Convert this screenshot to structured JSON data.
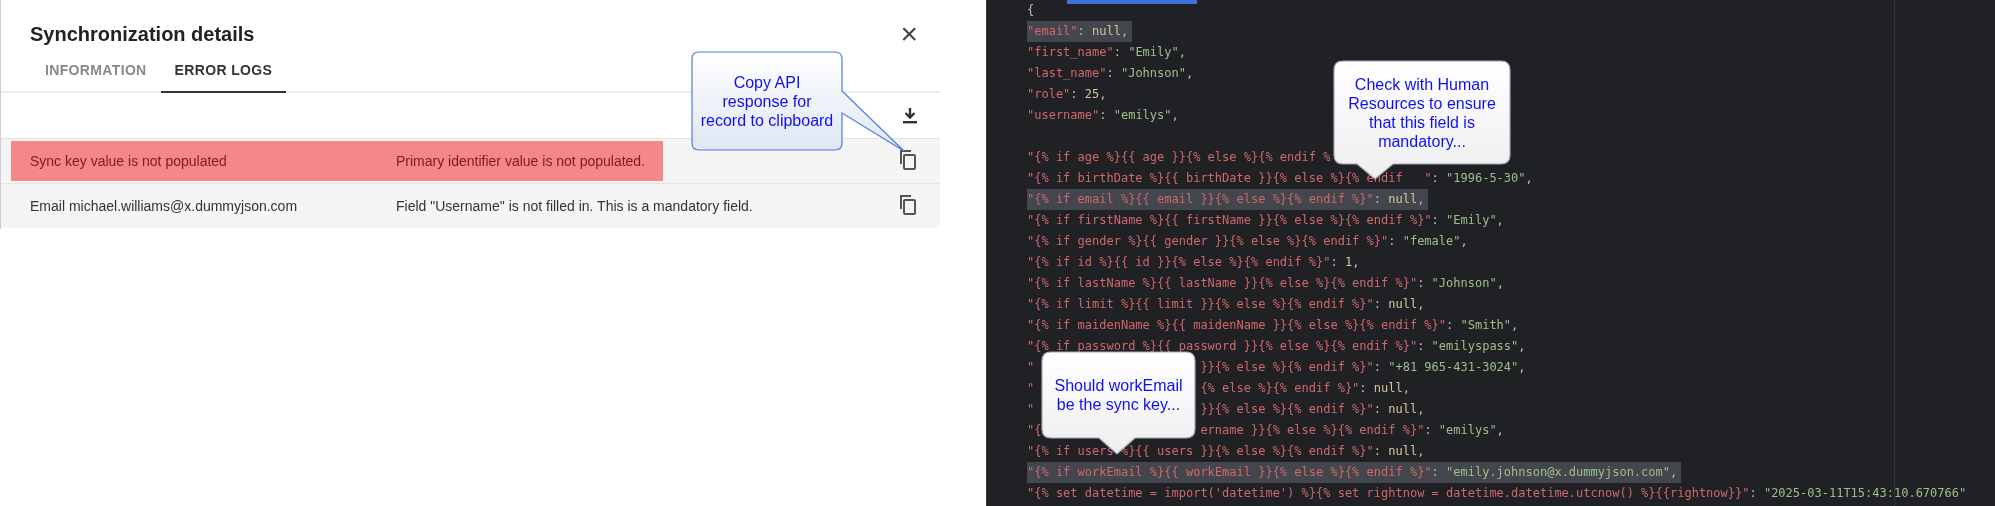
{
  "dialog": {
    "title": "Synchronization details",
    "close": "×",
    "tabs": [
      {
        "label": "INFORMATION",
        "selected": false
      },
      {
        "label": "ERROR LOGS",
        "selected": true
      }
    ],
    "rows": [
      {
        "key": "Sync key value is not populated",
        "message": "Primary identifier value is not populated.",
        "highlighted": true
      },
      {
        "key": "Email michael.williams@x.dummyjson.com",
        "message": "Field \"Username\" is not filled in. This is a mandatory field.",
        "highlighted": false
      }
    ]
  },
  "editor": {
    "lines": [
      {
        "highlighted": false,
        "parts": [
          {
            "kind": "punct",
            "text": "{"
          }
        ]
      },
      {
        "highlighted": true,
        "parts": [
          {
            "kind": "key",
            "text": "\"email\""
          },
          {
            "kind": "punct",
            "text": ": "
          },
          {
            "kind": "literal",
            "text": "null"
          },
          {
            "kind": "punct",
            "text": ","
          }
        ]
      },
      {
        "highlighted": false,
        "parts": [
          {
            "kind": "key",
            "text": "\"first_name\""
          },
          {
            "kind": "punct",
            "text": ": "
          },
          {
            "kind": "string",
            "text": "\"Emily\""
          },
          {
            "kind": "punct",
            "text": ","
          }
        ]
      },
      {
        "highlighted": false,
        "parts": [
          {
            "kind": "key",
            "text": "\"last_name\""
          },
          {
            "kind": "punct",
            "text": ": "
          },
          {
            "kind": "string",
            "text": "\"Johnson\""
          },
          {
            "kind": "punct",
            "text": ","
          }
        ]
      },
      {
        "highlighted": false,
        "parts": [
          {
            "kind": "key",
            "text": "\"role\""
          },
          {
            "kind": "punct",
            "text": ": "
          },
          {
            "kind": "literal",
            "text": "25"
          },
          {
            "kind": "punct",
            "text": ","
          }
        ]
      },
      {
        "highlighted": false,
        "parts": [
          {
            "kind": "key",
            "text": "\"username\""
          },
          {
            "kind": "punct",
            "text": ": "
          },
          {
            "kind": "string",
            "text": "\"emilys\""
          },
          {
            "kind": "punct",
            "text": ","
          }
        ]
      },
      {
        "highlighted": false,
        "blank_before": true,
        "parts": [
          {
            "kind": "key",
            "text": "\"{% if age %}{{ age }}{% else %}{% endif %"
          }
        ]
      },
      {
        "highlighted": false,
        "parts": [
          {
            "kind": "key",
            "text": "\"{% if birthDate %}{{ birthDate }}{% else %}{% endif"
          },
          {
            "kind": "gap"
          },
          {
            "kind": "key",
            "text": "\""
          },
          {
            "kind": "punct",
            "text": ": "
          },
          {
            "kind": "string",
            "text": "\"1996-5-30\""
          },
          {
            "kind": "punct",
            "text": ","
          }
        ]
      },
      {
        "highlighted": true,
        "parts": [
          {
            "kind": "key",
            "text": "\"{% if email %}{{ email }}{% else %}{% endif %}\""
          },
          {
            "kind": "punct",
            "text": ": "
          },
          {
            "kind": "literal",
            "text": "null"
          },
          {
            "kind": "punct",
            "text": ","
          }
        ]
      },
      {
        "highlighted": false,
        "parts": [
          {
            "kind": "key",
            "text": "\"{% if firstName %}{{ firstName }}{% else %}{% endif %}\""
          },
          {
            "kind": "punct",
            "text": ": "
          },
          {
            "kind": "string",
            "text": "\"Emily\""
          },
          {
            "kind": "punct",
            "text": ","
          }
        ]
      },
      {
        "highlighted": false,
        "parts": [
          {
            "kind": "key",
            "text": "\"{% if gender %}{{ gender }}{% else %}{% endif %}\""
          },
          {
            "kind": "punct",
            "text": ": "
          },
          {
            "kind": "string",
            "text": "\"female\""
          },
          {
            "kind": "punct",
            "text": ","
          }
        ]
      },
      {
        "highlighted": false,
        "parts": [
          {
            "kind": "key",
            "text": "\"{% if id %}{{ id }}{% else %}{% endif %}\""
          },
          {
            "kind": "punct",
            "text": ": "
          },
          {
            "kind": "literal",
            "text": "1"
          },
          {
            "kind": "punct",
            "text": ","
          }
        ]
      },
      {
        "highlighted": false,
        "parts": [
          {
            "kind": "key",
            "text": "\"{% if lastName %}{{ lastName }}{% else %}{% endif %}\""
          },
          {
            "kind": "punct",
            "text": ": "
          },
          {
            "kind": "string",
            "text": "\"Johnson\""
          },
          {
            "kind": "punct",
            "text": ","
          }
        ]
      },
      {
        "highlighted": false,
        "parts": [
          {
            "kind": "key",
            "text": "\"{% if limit %}{{ limit }}{% else %}{% endif %}\""
          },
          {
            "kind": "punct",
            "text": ": "
          },
          {
            "kind": "literal",
            "text": "null"
          },
          {
            "kind": "punct",
            "text": ","
          }
        ]
      },
      {
        "highlighted": false,
        "parts": [
          {
            "kind": "key",
            "text": "\"{% if maidenName %}{{ maidenName }}{% else %}{% endif %}\""
          },
          {
            "kind": "punct",
            "text": ": "
          },
          {
            "kind": "string",
            "text": "\"Smith\""
          },
          {
            "kind": "punct",
            "text": ","
          }
        ]
      },
      {
        "highlighted": false,
        "parts": [
          {
            "kind": "key",
            "text": "\"{% if password %}{{ password }}{% else %}{% endif %}\""
          },
          {
            "kind": "punct",
            "text": ": "
          },
          {
            "kind": "string",
            "text": "\"emilyspass\""
          },
          {
            "kind": "punct",
            "text": ","
          }
        ]
      },
      {
        "highlighted": false,
        "parts": [
          {
            "kind": "key",
            "text": "\""
          },
          {
            "kind": "gap"
          },
          {
            "kind": "key",
            "text": "}}{% else %}{% endif %}\""
          },
          {
            "kind": "punct",
            "text": ": "
          },
          {
            "kind": "string",
            "text": "\"+81 965-431-3024\""
          },
          {
            "kind": "punct",
            "text": ","
          }
        ]
      },
      {
        "highlighted": false,
        "parts": [
          {
            "kind": "key",
            "text": "\""
          },
          {
            "kind": "gap"
          },
          {
            "kind": "key",
            "text": "{% else %}{% endif %}\""
          },
          {
            "kind": "punct",
            "text": ": "
          },
          {
            "kind": "literal",
            "text": "null"
          },
          {
            "kind": "punct",
            "text": ","
          }
        ]
      },
      {
        "highlighted": false,
        "parts": [
          {
            "kind": "key",
            "text": "\""
          },
          {
            "kind": "gap"
          },
          {
            "kind": "key",
            "text": "}}{% else %}{% endif %}\""
          },
          {
            "kind": "punct",
            "text": ": "
          },
          {
            "kind": "literal",
            "text": "null"
          },
          {
            "kind": "punct",
            "text": ","
          }
        ]
      },
      {
        "highlighted": false,
        "parts": [
          {
            "kind": "key",
            "text": "\"{"
          },
          {
            "kind": "gap"
          },
          {
            "kind": "key",
            "text": "ername }}{% else %}{% endif %}\""
          },
          {
            "kind": "punct",
            "text": ": "
          },
          {
            "kind": "string",
            "text": "\"emilys\""
          },
          {
            "kind": "punct",
            "text": ","
          }
        ]
      },
      {
        "highlighted": false,
        "parts": [
          {
            "kind": "key",
            "text": "\"{% if users %}{{ users }}{% else %}{% endif %}\""
          },
          {
            "kind": "punct",
            "text": ": "
          },
          {
            "kind": "literal",
            "text": "null"
          },
          {
            "kind": "punct",
            "text": ","
          }
        ]
      },
      {
        "highlighted": true,
        "parts": [
          {
            "kind": "key",
            "text": "\"{% if workEmail %}{{ workEmail }}{% else %}{% endif %}\""
          },
          {
            "kind": "punct",
            "text": ": "
          },
          {
            "kind": "string",
            "text": "\"emily.johnson@x.dummyjson.com\""
          },
          {
            "kind": "punct",
            "text": ","
          }
        ]
      },
      {
        "highlighted": false,
        "parts": [
          {
            "kind": "key",
            "text": "\"{% set datetime = import('datetime') %}{% set rightnow = datetime.datetime.utcnow() %}{{rightnow}}\""
          },
          {
            "kind": "punct",
            "text": ": "
          },
          {
            "kind": "string",
            "text": "\"2025-03-11T15:43:10.670766\""
          }
        ]
      }
    ]
  },
  "callouts": [
    {
      "text": "Copy API response for record to clipboard",
      "kind": "side"
    },
    {
      "text": "Check with Human Resources to ensure that this field is mandatory...",
      "kind": "bottom"
    },
    {
      "text": "Should workEmail be the sync key...",
      "kind": "bottom"
    }
  ]
}
